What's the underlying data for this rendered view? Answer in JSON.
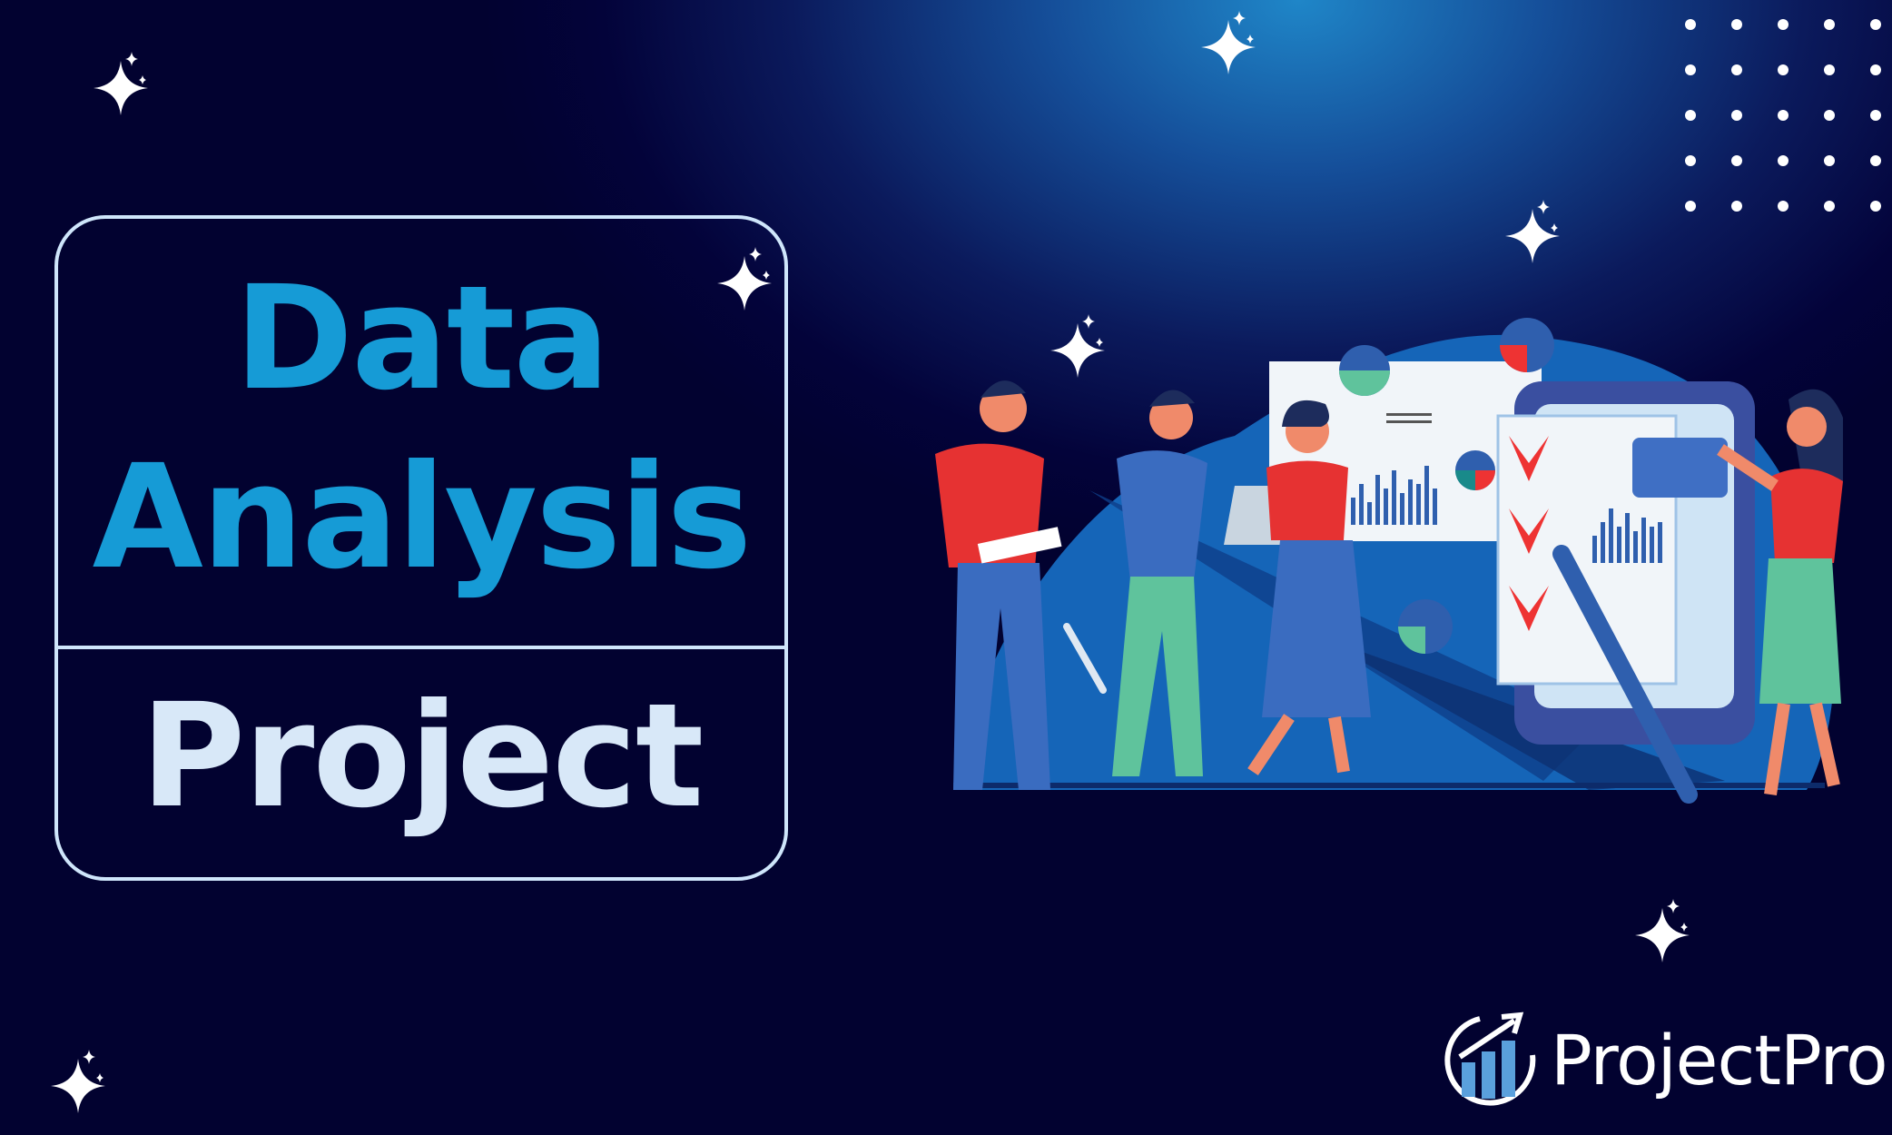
{
  "title": {
    "line1": "Data",
    "line2": "Analysis",
    "line3": "Project"
  },
  "brand": {
    "name": "ProjectPro",
    "icon": "rising-bar-chart-logo-icon"
  },
  "colors": {
    "title_accent": "#169bd6",
    "title_light": "#d8e8f8",
    "background": "#03033a",
    "frame": "#cfe6fb"
  },
  "decorations": {
    "sparkle_icon": "four-point-star-icon",
    "dot_grid": "dot-grid-pattern"
  }
}
